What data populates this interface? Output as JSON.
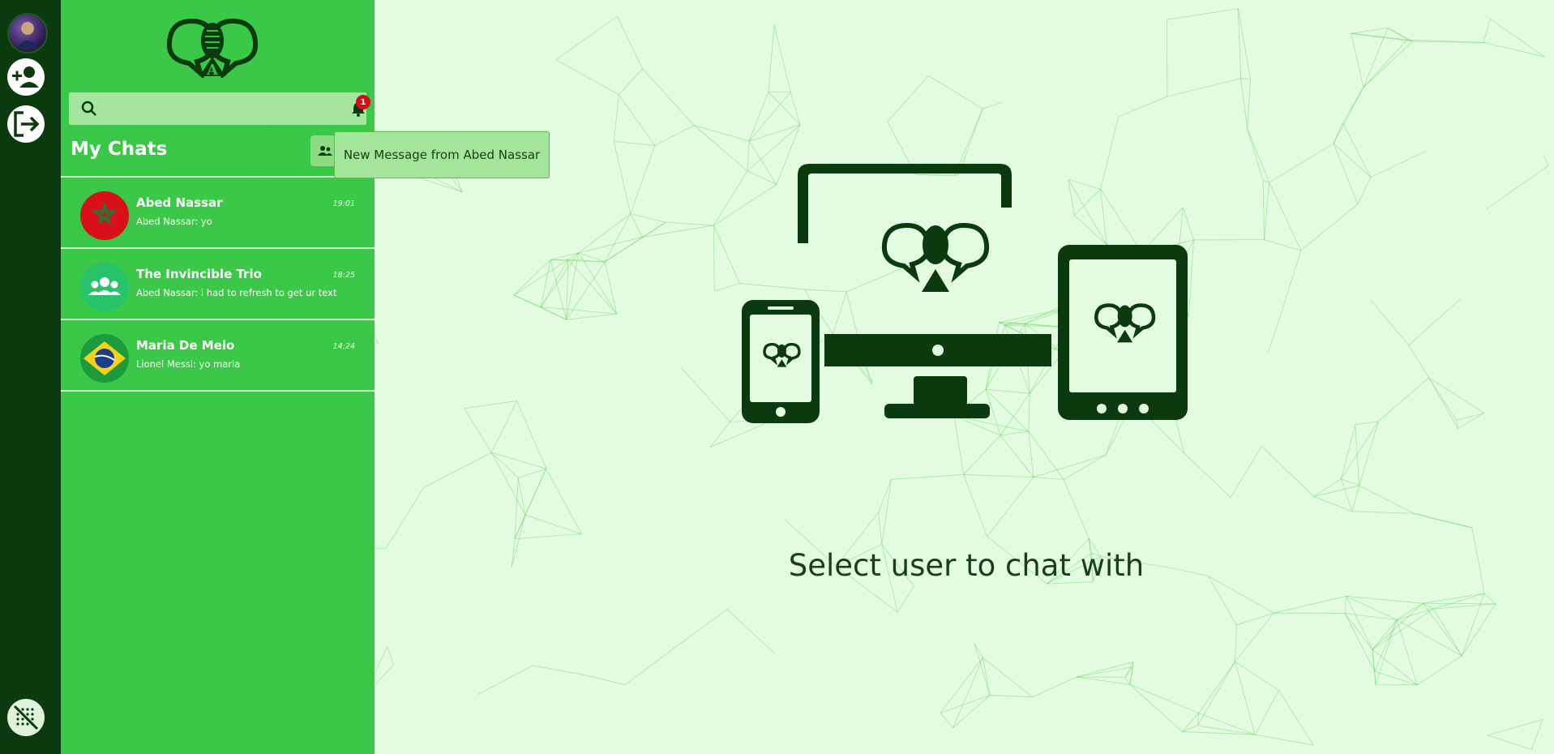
{
  "rail": {
    "items": [
      {
        "icon": "profile-avatar"
      },
      {
        "icon": "add-user-icon"
      },
      {
        "icon": "logout-icon"
      },
      {
        "icon": "background-toggle-icon"
      }
    ]
  },
  "sidebar": {
    "logo_letter": "A",
    "search": {
      "placeholder": "",
      "value": ""
    },
    "notification_count": "1",
    "title": "My Chats",
    "chats": [
      {
        "name": "Abed Nassar",
        "preview": "Abed Nassar: yo",
        "time": "19:01",
        "avatar": "morocco-flag"
      },
      {
        "name": "The Invincible Trio",
        "preview": "Abed Nassar: i had to refresh to get ur text",
        "time": "18:25",
        "avatar": "group-icon"
      },
      {
        "name": "Maria De Melo",
        "preview": "Lionel Messi: yo maria",
        "time": "14:24",
        "avatar": "brazil-flag"
      }
    ]
  },
  "toast": {
    "text": "New Message from Abed Nassar"
  },
  "main": {
    "empty_state": "Select user to chat with"
  },
  "colors": {
    "rail": "#0b3a0f",
    "sidebar": "#2ec43d",
    "main_bg": "#e3fbe1",
    "accent_dark": "#0b3a0f",
    "badge": "#e30613"
  }
}
